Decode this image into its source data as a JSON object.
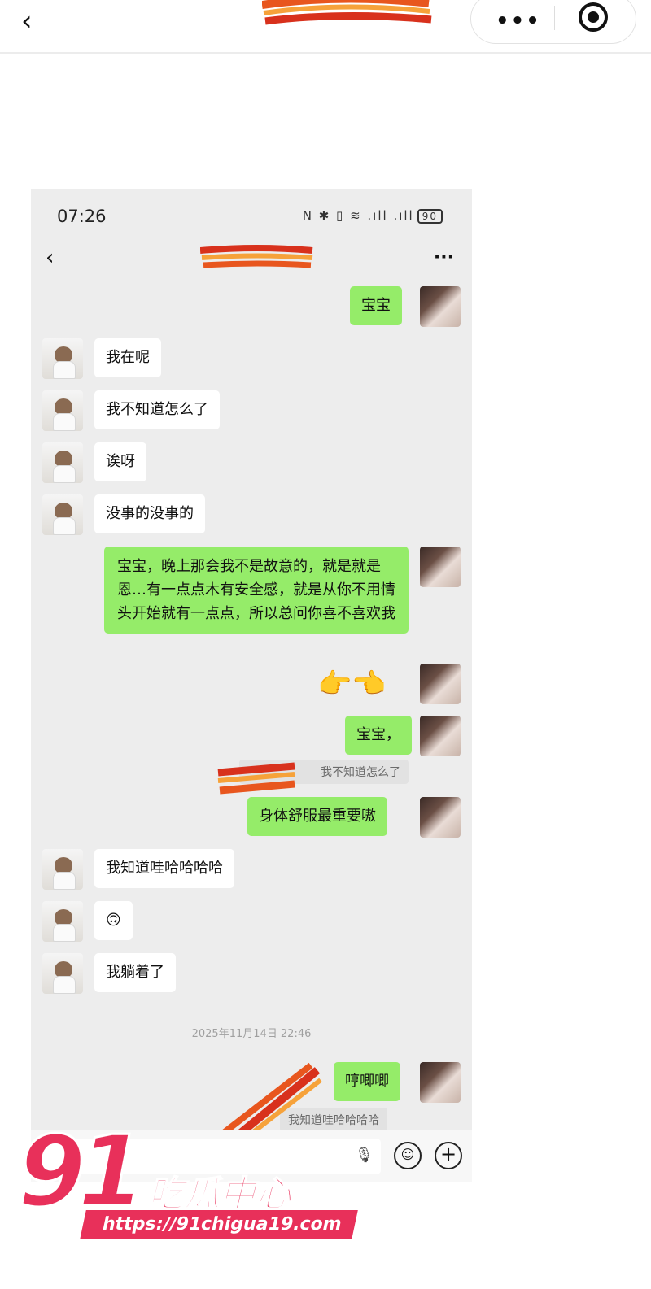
{
  "header": {
    "back_icon": "chevron-left-icon",
    "more_icon": "more-dots-icon",
    "close_icon": "target-icon"
  },
  "phone": {
    "time": "07:26",
    "battery": "90",
    "chat_more": "···"
  },
  "messages": [
    {
      "side": "me",
      "text": "宝宝"
    },
    {
      "side": "them",
      "text": "我在呢"
    },
    {
      "side": "them",
      "text": "我不知道怎么了"
    },
    {
      "side": "them",
      "text": "诶呀"
    },
    {
      "side": "them",
      "text": "没事的没事的"
    },
    {
      "side": "me",
      "text": "宝宝，晚上那会我不是故意的，就是就是恩…有一点点木有安全感，就是从你不用情头开始就有一点点，所以总问你喜不喜欢我"
    },
    {
      "side": "me",
      "text": "👉👈"
    },
    {
      "side": "me",
      "text": "宝宝，"
    },
    {
      "side": "quote",
      "text": "我不知道怎么了"
    },
    {
      "side": "me",
      "text": "身体舒服最重要嗷"
    },
    {
      "side": "them",
      "text": "我知道哇哈哈哈哈"
    },
    {
      "side": "them",
      "text": "🙃"
    },
    {
      "side": "them",
      "text": "我躺着了"
    },
    {
      "side": "time",
      "text": "2025年11月14日 22:46"
    },
    {
      "side": "me",
      "text": "哼唧唧"
    },
    {
      "side": "quote",
      "text": "我知道哇哈哈哈哈"
    }
  ],
  "inputbar": {
    "voice_icon": "mic-icon",
    "emoji_icon": "emoji-icon",
    "plus_icon": "plus-icon"
  },
  "watermark": {
    "number": "91",
    "name": "吃瓜中心",
    "url": "https://91chigua19.com"
  },
  "colors": {
    "my_bubble": "#95ec69",
    "their_bubble": "#ffffff",
    "chat_bg": "#ededed",
    "watermark": "#e8305a",
    "redaction": "#e8561e"
  }
}
